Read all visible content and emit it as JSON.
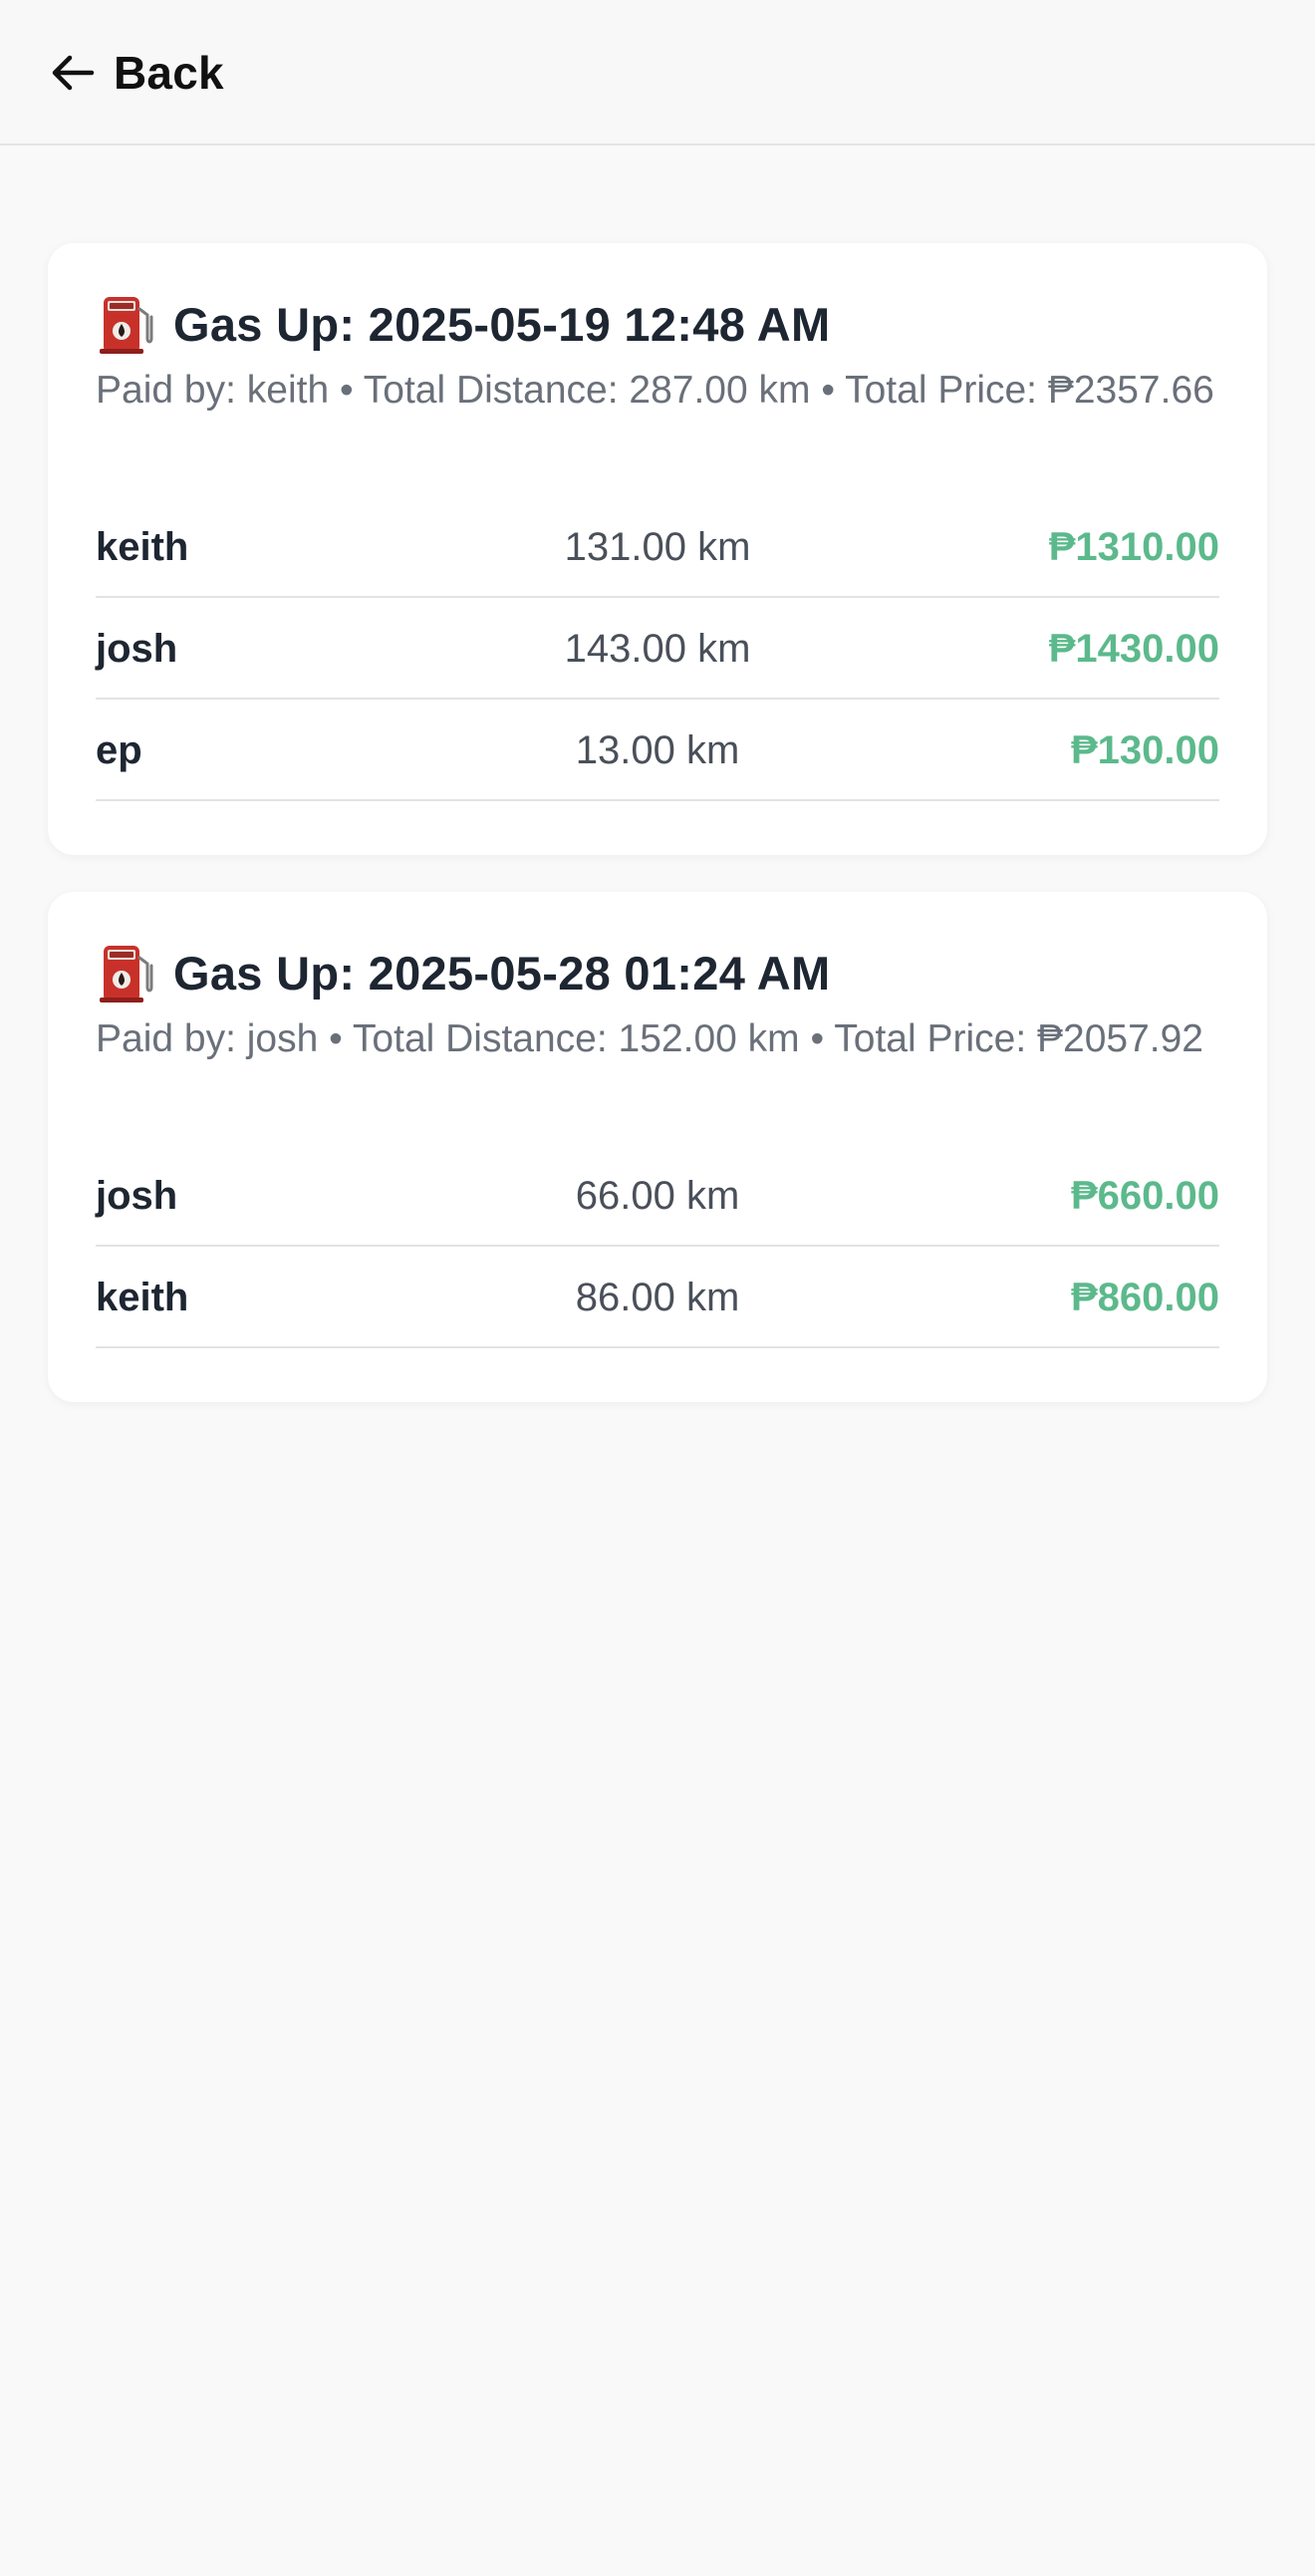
{
  "header": {
    "back_label": "Back"
  },
  "gas_ups": [
    {
      "title": "Gas Up: 2025-05-19 12:48 AM",
      "summary": "Paid by: keith • Total Distance: 287.00 km • Total Price: ₱2357.66",
      "rows": [
        {
          "name": "keith",
          "distance": "131.00 km",
          "amount": "₱1310.00"
        },
        {
          "name": "josh",
          "distance": "143.00 km",
          "amount": "₱1430.00"
        },
        {
          "name": "ep",
          "distance": "13.00 km",
          "amount": "₱130.00"
        }
      ]
    },
    {
      "title": "Gas Up: 2025-05-28 01:24 AM",
      "summary": "Paid by: josh • Total Distance: 152.00 km • Total Price: ₱2057.92",
      "rows": [
        {
          "name": "josh",
          "distance": "66.00 km",
          "amount": "₱660.00"
        },
        {
          "name": "keith",
          "distance": "86.00 km",
          "amount": "₱860.00"
        }
      ]
    }
  ],
  "icons": {
    "back": "arrow-left-icon",
    "gas": "fuel-pump-icon"
  },
  "colors": {
    "amount": "#5cb98c",
    "title": "#1e2632",
    "muted": "#6a707a",
    "background": "#f9f9f9",
    "card": "#ffffff",
    "pump": "#c8312a"
  }
}
